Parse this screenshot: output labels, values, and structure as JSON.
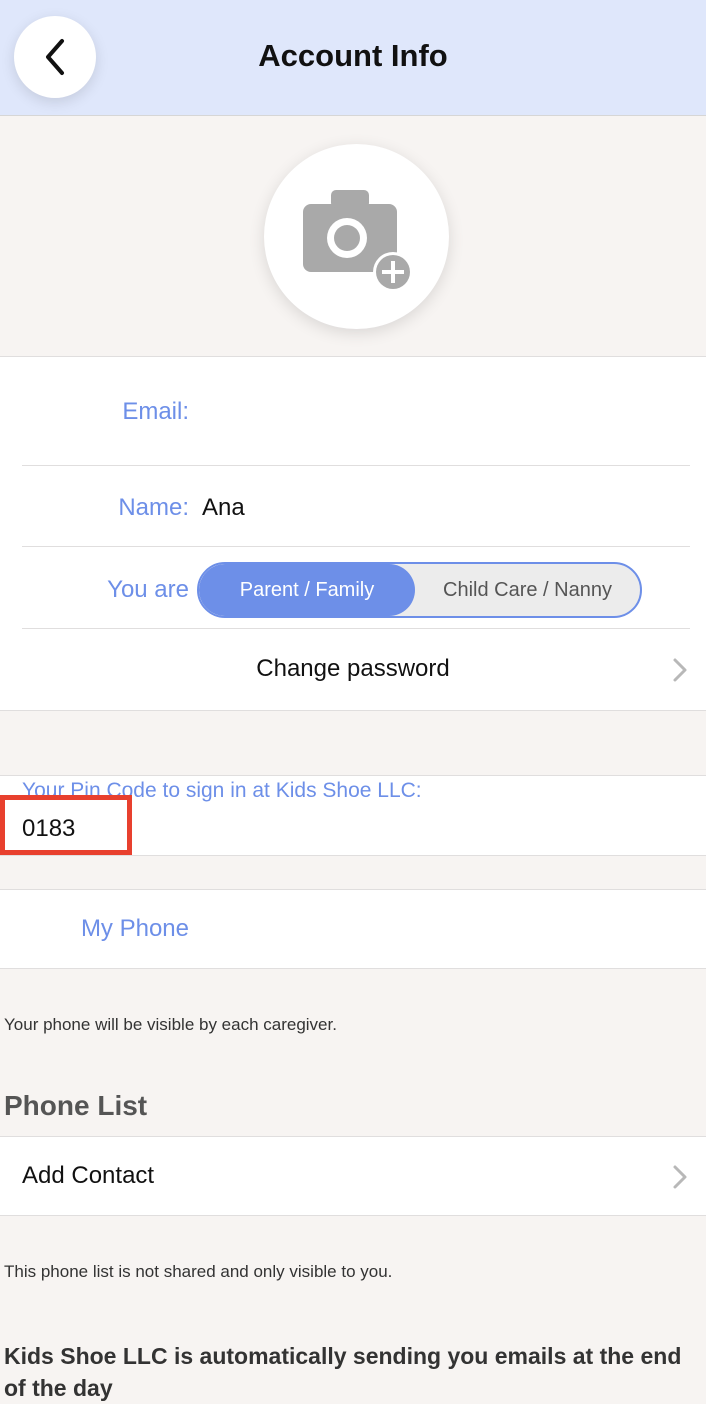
{
  "header": {
    "title": "Account Info"
  },
  "profile": {
    "photo_icon": "camera-plus-icon"
  },
  "account": {
    "email_label": "Email:",
    "email_value": "",
    "name_label": "Name:",
    "name_value": "Ana",
    "role_label": "You are",
    "role_options": [
      "Parent / Family",
      "Child Care / Nanny"
    ],
    "role_selected": "Parent / Family",
    "change_password": "Change password"
  },
  "pin": {
    "label": "Your Pin Code to sign in at Kids Shoe LLC:",
    "value": "0183"
  },
  "phone": {
    "label": "My Phone",
    "note": "Your phone will be visible by each caregiver."
  },
  "phone_list": {
    "heading": "Phone List",
    "add_contact": "Add Contact",
    "note": "This phone list is not shared and only visible to you."
  },
  "footer_text": "Kids Shoe LLC is automatically sending you emails at the end of the day",
  "colors": {
    "accent": "#6d8fe8",
    "header_bg": "#dfe7fb",
    "highlight": "#e8402e"
  }
}
